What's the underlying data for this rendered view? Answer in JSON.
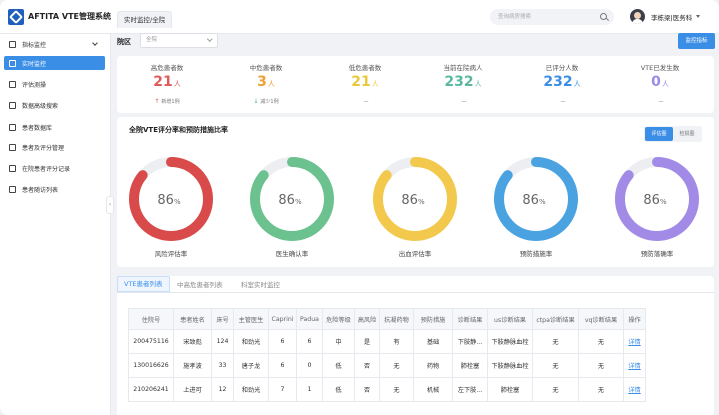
{
  "app": {
    "title": "AFTITA VTE管理系统",
    "tab": "实时监控/全院"
  },
  "search": {
    "placeholder": "查询病房搜索"
  },
  "user": {
    "name": "李栋梁|医务科"
  },
  "sidebar": {
    "items": [
      {
        "label": "指标监控",
        "icon": "monitor-icon"
      },
      {
        "label": "实时监控",
        "icon": "realtime-icon",
        "active": true
      },
      {
        "label": "评估测操",
        "icon": "assess-icon"
      },
      {
        "label": "数据高级搜索",
        "icon": "search-data-icon"
      },
      {
        "label": "患者数据库",
        "icon": "database-icon"
      },
      {
        "label": "患者及评分管理",
        "icon": "score-icon"
      },
      {
        "label": "在院患者评分记录",
        "icon": "record-icon"
      },
      {
        "label": "患者随访列表",
        "icon": "followup-icon"
      }
    ]
  },
  "filter": {
    "label": "院区",
    "select_value": "全院",
    "button": "监控指标"
  },
  "stats": [
    {
      "label": "高危患者数",
      "value": "21",
      "unit": "人",
      "sub": "新增1例",
      "arrow": "↑",
      "color": "#e05a5a",
      "arrow_color": "#e05a5a"
    },
    {
      "label": "中危患者数",
      "value": "3",
      "unit": "人",
      "sub": "减少1例",
      "arrow": "↓",
      "color": "#f0a030",
      "arrow_color": "#3cb371"
    },
    {
      "label": "低危患者数",
      "value": "21",
      "unit": "人",
      "sub": "—",
      "arrow": "",
      "color": "#e8c93a",
      "arrow_color": "#777"
    },
    {
      "label": "当前在院病人",
      "value": "232",
      "unit": "人",
      "sub": "—",
      "arrow": "",
      "color": "#5ab8a0",
      "arrow_color": "#777"
    },
    {
      "label": "已评分人数",
      "value": "232",
      "unit": "人",
      "sub": "—",
      "arrow": "",
      "color": "#3a8ee6",
      "arrow_color": "#777"
    },
    {
      "label": "VTE已发生数",
      "value": "0",
      "unit": "人",
      "sub": "—",
      "arrow": "",
      "color": "#9a8de8",
      "arrow_color": "#777"
    }
  ],
  "charts": {
    "title": "全院VTE评分率和预防措施比率",
    "toggle": {
      "on": "评估图",
      "off": "检损图"
    },
    "gauges": [
      {
        "label": "风险评估率",
        "value": 86,
        "display": "86",
        "unit": "%",
        "color": "#d94a4a"
      },
      {
        "label": "医生确认率",
        "value": 86,
        "display": "86",
        "unit": "%",
        "color": "#6cc28e"
      },
      {
        "label": "出血评估率",
        "value": 86,
        "display": "86",
        "unit": "%",
        "color": "#f2c94c"
      },
      {
        "label": "预防措施率",
        "value": 86,
        "display": "86",
        "unit": "%",
        "color": "#4aa3e0"
      },
      {
        "label": "预防落确率",
        "value": 86,
        "display": "86",
        "unit": "%",
        "color": "#a28be6"
      }
    ]
  },
  "table": {
    "tabs": [
      "VTE患者列表",
      "中高危患者列表",
      "科室实时监控"
    ],
    "columns": [
      "住院号",
      "患者姓名",
      "床号",
      "主管医生",
      "Caprini",
      "Padua",
      "危险等级",
      "高风险",
      "抗凝药物",
      "预防措施",
      "诊断结果",
      "us诊断结果",
      "ctpa诊断结果",
      "vq诊断结果",
      "操作"
    ],
    "rows": [
      [
        "200475116",
        "宋致彪",
        "124",
        "和劲光",
        "6",
        "6",
        "中",
        "是",
        "有",
        "基础",
        "下肢静...",
        "下肢静脉血栓",
        "无",
        "无",
        "详情"
      ],
      [
        "130016626",
        "施孝波",
        "33",
        "唐子龙",
        "6",
        "0",
        "低",
        "否",
        "无",
        "药物",
        "肺栓塞",
        "下肢静脉血栓",
        "无",
        "无",
        "详情"
      ],
      [
        "210206241",
        "上进可",
        "12",
        "和劲光",
        "7",
        "1",
        "低",
        "否",
        "无",
        "机械",
        "左下肢...",
        "肺栓塞",
        "无",
        "无",
        "详情"
      ]
    ]
  }
}
